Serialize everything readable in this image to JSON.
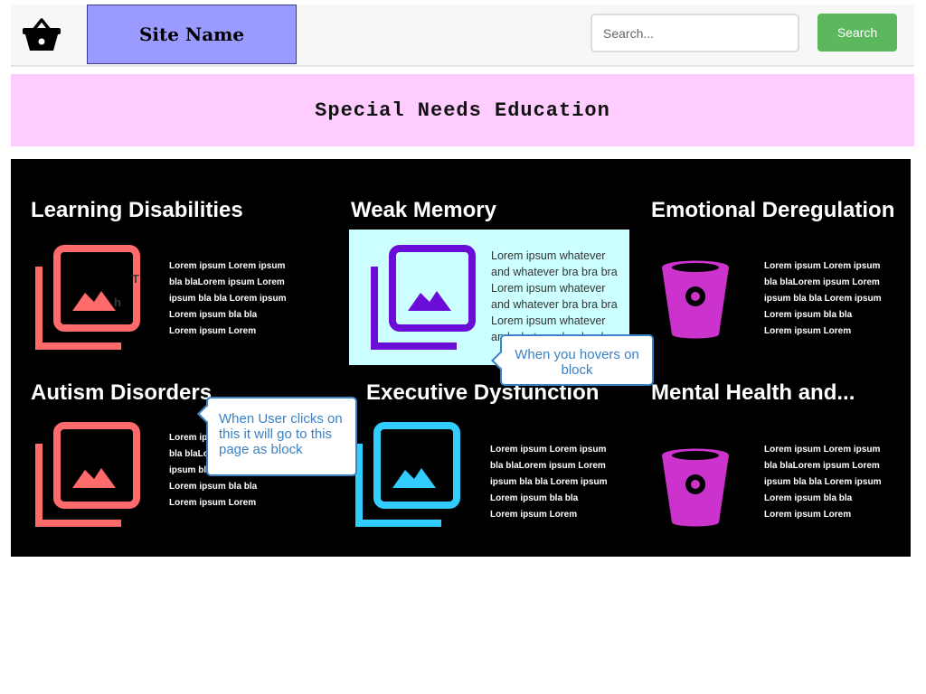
{
  "header": {
    "site_name": "Site Name",
    "search_placeholder": "Search...",
    "search_button": "Search"
  },
  "banner": {
    "title": "Special Needs Education"
  },
  "cards": [
    {
      "title": "Learning Disabilities",
      "text": "Lorem ipsum Lorem ipsum bla blaLorem ipsum Lorem ipsum bla bla Lorem ipsum Lorem ipsum bla bla Lorem ipsum Lorem",
      "icon": "image-gallery-icon",
      "icon_color": "#ff6b6b"
    },
    {
      "title": "Weak Memory",
      "text": "Lorem ipsum whatever and whatever bra bra bra Lorem ipsum whatever and whatever bra bra bra Lorem ipsum whatever and whatever bra bra bra",
      "icon": "image-gallery-icon",
      "icon_color": "#6a0dd6"
    },
    {
      "title": "Emotional Deregulation",
      "text": "Lorem ipsum Lorem ipsum bla blaLorem ipsum Lorem ipsum bla bla Lorem ipsum Lorem ipsum bla bla Lorem ipsum Lorem",
      "icon": "bitbucket-icon",
      "icon_color": "#cc33cc"
    },
    {
      "title": "Autism Disorders",
      "text": "Lorem ipsum Lorem ipsum bla blaLorem ipsum Lorem ipsum bla bla Lorem ipsum Lorem ipsum bla bla Lorem ipsum Lorem",
      "icon": "image-gallery-icon",
      "icon_color": "#ff6b6b"
    },
    {
      "title": "Executive Dysfunction",
      "text": "Lorem ipsum Lorem ipsum bla blaLorem ipsum Lorem ipsum bla bla Lorem ipsum Lorem ipsum bla bla Lorem ipsum Lorem",
      "icon": "image-gallery-icon",
      "icon_color": "#33ccff"
    },
    {
      "title": "Mental Health and...",
      "text": "Lorem ipsum Lorem ipsum bla blaLorem ipsum Lorem ipsum bla bla Lorem ipsum Lorem ipsum bla bla Lorem ipsum Lorem",
      "icon": "bitbucket-icon",
      "icon_color": "#cc33cc"
    }
  ],
  "tooltips": {
    "hover": "When you hovers on block",
    "click": "When User clicks on this it will go to this page as block"
  },
  "colors": {
    "header_bg": "#f7f7f7",
    "site_name_bg": "#9b9bff",
    "banner_bg": "#ffccff",
    "panel_bg": "#000000",
    "highlight_bg": "#ccffff",
    "search_button": "#5cb85c",
    "tooltip": "#3a82c4"
  }
}
